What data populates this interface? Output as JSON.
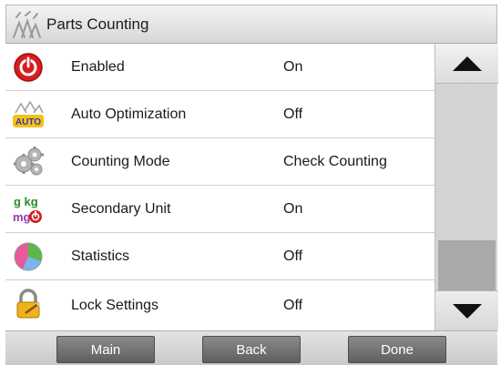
{
  "header": {
    "title": "Parts Counting",
    "icon": "parts-counting-icon"
  },
  "rows": [
    {
      "label": "Enabled",
      "value": "On",
      "icon": "power-icon"
    },
    {
      "label": "Auto Optimization",
      "value": "Off",
      "icon": "auto-optimization-icon",
      "icon_text": "AUTO"
    },
    {
      "label": "Counting Mode",
      "value": "Check Counting",
      "icon": "gears-icon"
    },
    {
      "label": "Secondary Unit",
      "value": "On",
      "icon": "unit-icon",
      "icon_text_top": "g kg",
      "icon_text_bottom": "mg"
    },
    {
      "label": "Statistics",
      "value": "Off",
      "icon": "pie-chart-icon"
    },
    {
      "label": "Lock Settings",
      "value": "Off",
      "icon": "lock-icon"
    }
  ],
  "scroll": {
    "up_icon": "arrow-up-icon",
    "down_icon": "arrow-down-icon",
    "position_fraction": 0.8
  },
  "footer": {
    "main_label": "Main",
    "back_label": "Back",
    "done_label": "Done"
  },
  "colors": {
    "accent_red": "#d61e1e",
    "button_gray": "#6f6f6f",
    "thumb": "#a9a9a9"
  }
}
